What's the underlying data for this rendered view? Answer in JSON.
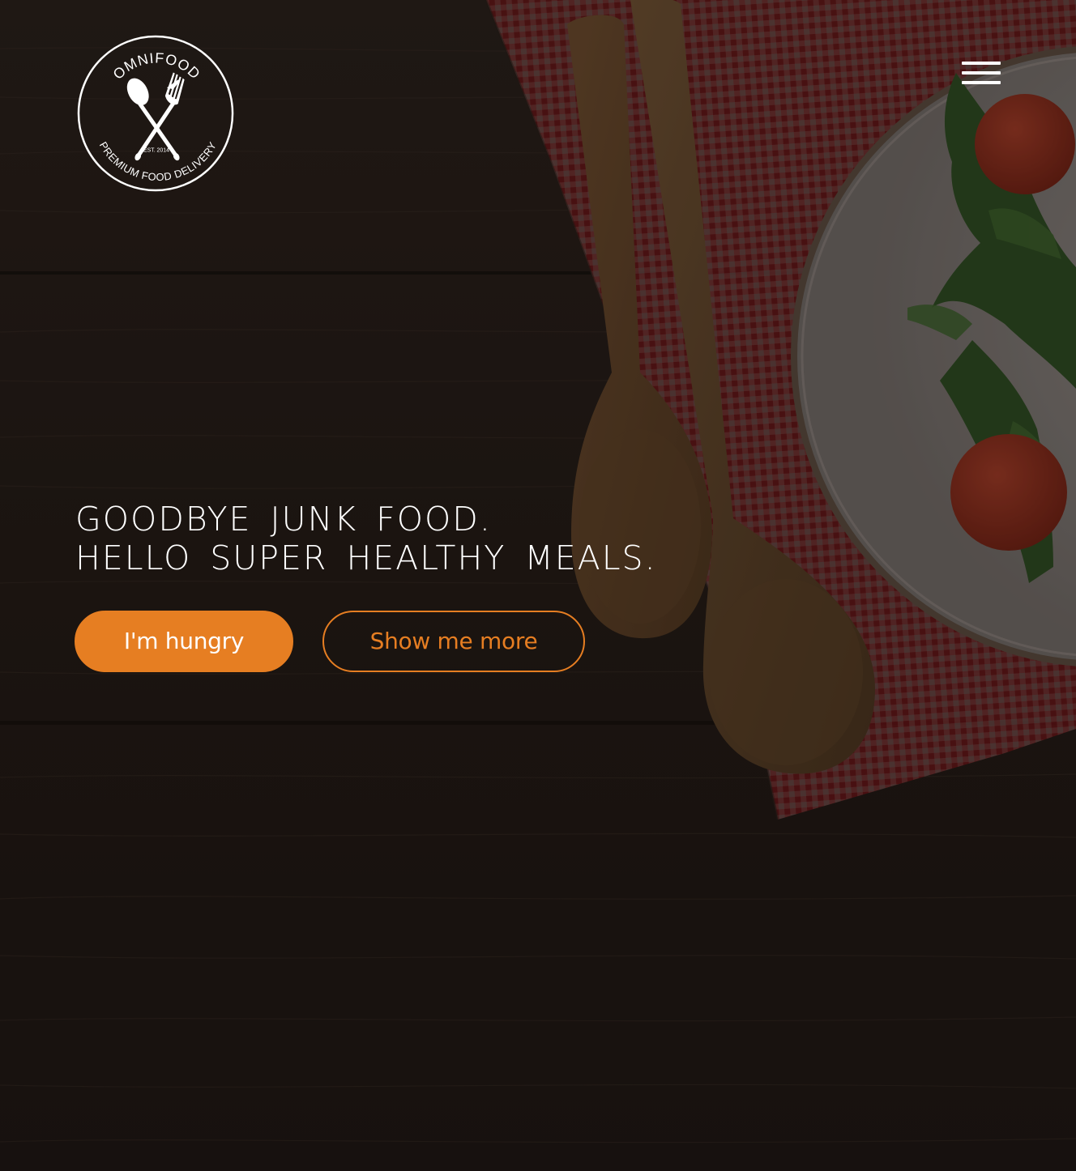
{
  "brand": {
    "name": "OMNIFOOD",
    "tagline": "PREMIUM FOOD DELIVERY",
    "established": "EST. 2014",
    "accent_color": "#e67e22"
  },
  "nav": {
    "menu_icon": "hamburger-menu-icon"
  },
  "hero": {
    "headline_line1": "Goodbye junk food.",
    "headline_line2": "Hello super healthy meals.",
    "primary_button": "I'm hungry",
    "secondary_button": "Show me more"
  }
}
